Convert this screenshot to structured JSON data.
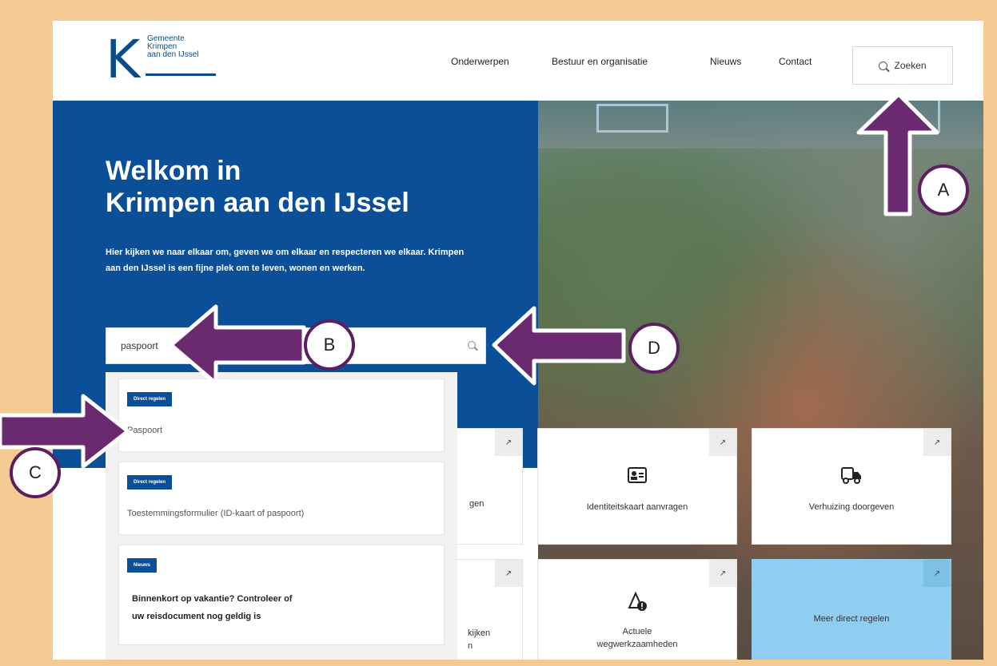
{
  "header": {
    "logo": {
      "lines": [
        "Gemeente",
        "Krimpen",
        "aan den IJssel"
      ]
    },
    "nav": [
      "Onderwerpen",
      "Bestuur en organisatie",
      "Nieuws",
      "Contact"
    ],
    "search_label": "Zoeken"
  },
  "hero": {
    "title_line1": "Welkom in",
    "title_line2": "Krimpen aan den IJssel",
    "intro": "Hier kijken we naar elkaar om, geven we om elkaar en respecteren we elkaar. Krimpen aan den IJssel is een fijne plek om te leven, wonen en werken.",
    "search_value": "paspoort"
  },
  "results": [
    {
      "badge": "Direct regelen",
      "text": "Paspoort"
    },
    {
      "badge": "Direct regelen",
      "text": "Toestemmingsformulier (ID-kaart of paspoort)"
    },
    {
      "badge": "Nieuws",
      "line1": "Binnenkort op vakantie? Controleer of",
      "line2": "uw reisdocument nog geldig is"
    }
  ],
  "tiles": [
    {
      "label_fragment": "gen"
    },
    {
      "label": "Identiteitskaart aanvragen",
      "icon": "id-card-icon"
    },
    {
      "label": "Verhuizing doorgeven",
      "icon": "truck-icon"
    },
    {
      "label_fragment_1": "kijken",
      "label_fragment_2": "n"
    },
    {
      "label_line1": "Actuele",
      "label_line2": "wegwerkzaamheden",
      "icon": "roadwork-alert-icon"
    },
    {
      "label": "Meer direct regelen"
    }
  ],
  "annotations": {
    "A": "A",
    "B": "B",
    "C": "C",
    "D": "D"
  },
  "colors": {
    "brand_blue": "#0a4f98",
    "light_blue": "#8fcdf1",
    "arrow_purple": "#6b2a6f",
    "frame_border": "#f5c992"
  }
}
